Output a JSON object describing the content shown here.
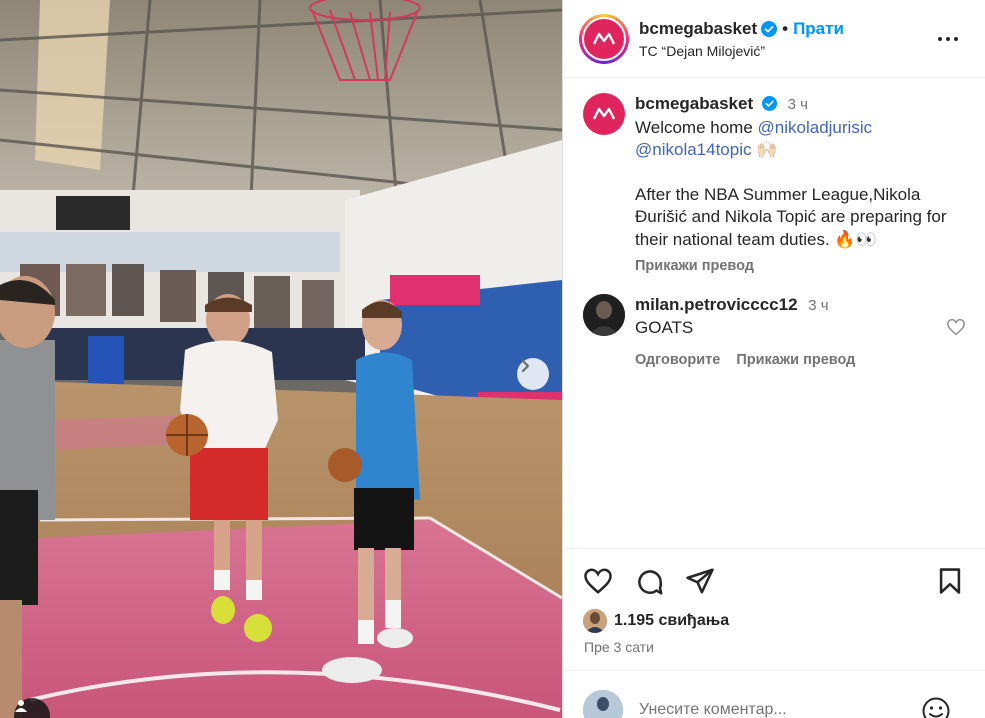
{
  "post": {
    "username": "bcmegabasket",
    "follow_label": "Прати",
    "location": "TC “Dejan Milojević”",
    "caption": {
      "time": "3 ч",
      "line1_prefix": "Welcome home ",
      "mention1": "@nikoladjurisic",
      "mention2": "@nikola14topic",
      "emoji1": "🙌🏻",
      "paragraph2": "After the NBA Summer League,Nikola Đurišić and Nikola Topić are preparing for their national team duties.",
      "emoji2": "🔥👀",
      "translate_label": "Прикажи превод"
    },
    "comment": {
      "username": "milan.petrovicccc12",
      "time": "3 ч",
      "text": "GOATS",
      "reply_label": "Одговорите",
      "translate_label": "Прикажи превод"
    },
    "likes_text": "1.195 свиђања",
    "posted_ago": "Пре 3 сати",
    "comment_placeholder": "Унесите коментар..."
  },
  "colors": {
    "brand": "#e0245e",
    "link": "#0095f6",
    "verified": "#0095f6",
    "court_pink": "#d9607f"
  },
  "icons": [
    "more-icon",
    "verified-icon",
    "heart-icon",
    "comment-icon",
    "share-icon",
    "bookmark-icon",
    "next-arrow-icon",
    "tag-user-icon",
    "emoji-icon"
  ]
}
